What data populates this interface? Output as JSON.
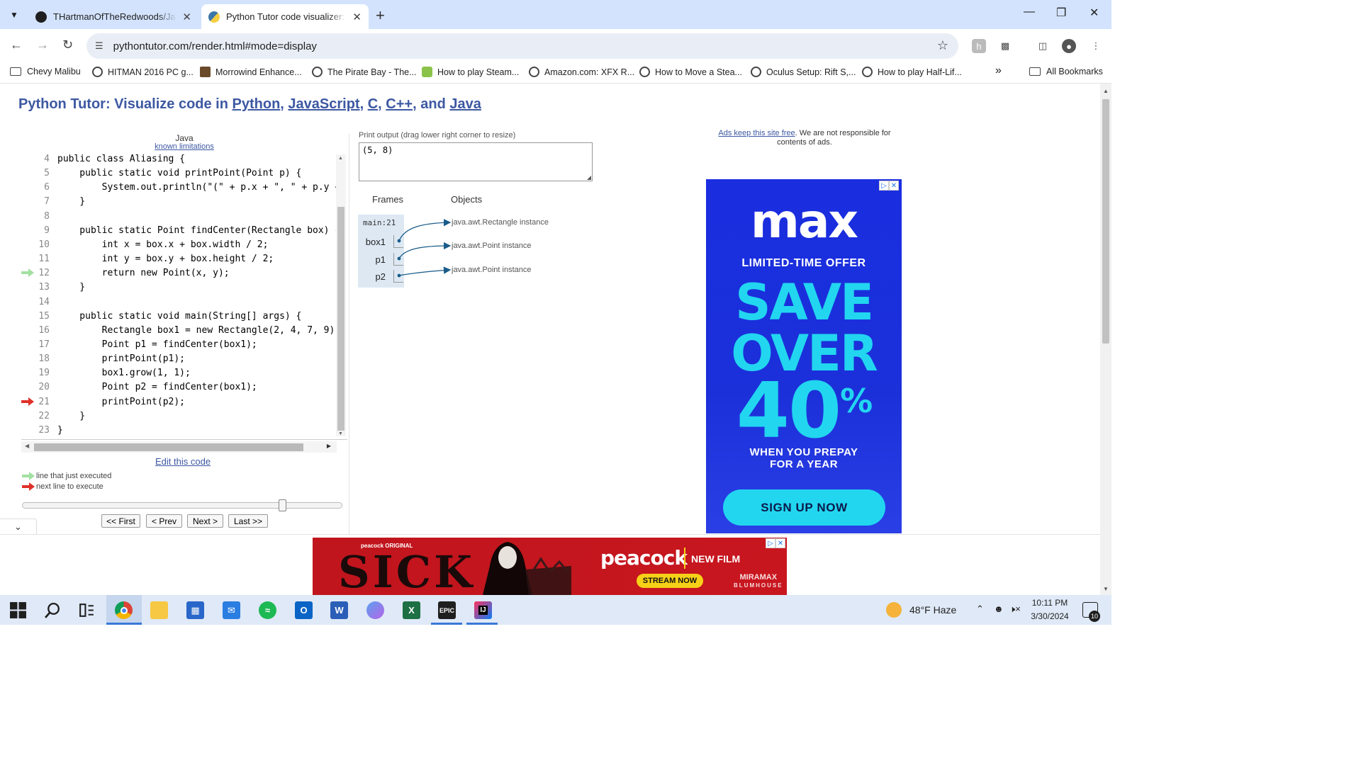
{
  "browser": {
    "tabs": [
      {
        "title": "THartmanOfTheRedwoods/Java",
        "active": false
      },
      {
        "title": "Python Tutor code visualizer: Vi",
        "active": true
      }
    ],
    "url": "pythontutor.com/render.html#mode=display",
    "bookmarks": [
      "Chevy Malibu",
      "HITMAN 2016 PC g...",
      "Morrowind Enhance...",
      "The Pirate Bay - The...",
      "How to play Steam...",
      "Amazon.com: XFX R...",
      "How to Move a Stea...",
      "Oculus Setup: Rift S,...",
      "How to play Half-Lif..."
    ],
    "all_bookmarks": "All Bookmarks",
    "overflow": "»"
  },
  "title": {
    "prefix": "Python Tutor: Visualize code in ",
    "python": "Python",
    "javascript": "JavaScript",
    "c": "C",
    "cpp": "C++",
    "and": ", and ",
    "java": "Java",
    "sep": ", "
  },
  "editor": {
    "language": "Java",
    "known_limitations": "known limitations",
    "lines": [
      {
        "num": "4",
        "code": "public class Aliasing {",
        "marker": ""
      },
      {
        "num": "5",
        "code": "    public static void printPoint(Point p) {",
        "marker": ""
      },
      {
        "num": "6",
        "code": "        System.out.println(\"(\" + p.x + \", \" + p.y + \"",
        "marker": ""
      },
      {
        "num": "7",
        "code": "    }",
        "marker": ""
      },
      {
        "num": "8",
        "code": "",
        "marker": ""
      },
      {
        "num": "9",
        "code": "    public static Point findCenter(Rectangle box) {",
        "marker": ""
      },
      {
        "num": "10",
        "code": "        int x = box.x + box.width / 2;",
        "marker": ""
      },
      {
        "num": "11",
        "code": "        int y = box.y + box.height / 2;",
        "marker": ""
      },
      {
        "num": "12",
        "code": "        return new Point(x, y);",
        "marker": "just-executed"
      },
      {
        "num": "13",
        "code": "    }",
        "marker": ""
      },
      {
        "num": "14",
        "code": "",
        "marker": ""
      },
      {
        "num": "15",
        "code": "    public static void main(String[] args) {",
        "marker": ""
      },
      {
        "num": "16",
        "code": "        Rectangle box1 = new Rectangle(2, 4, 7, 9);",
        "marker": ""
      },
      {
        "num": "17",
        "code": "        Point p1 = findCenter(box1);",
        "marker": ""
      },
      {
        "num": "18",
        "code": "        printPoint(p1);",
        "marker": ""
      },
      {
        "num": "19",
        "code": "        box1.grow(1, 1);",
        "marker": ""
      },
      {
        "num": "20",
        "code": "        Point p2 = findCenter(box1);",
        "marker": ""
      },
      {
        "num": "21",
        "code": "        printPoint(p2);",
        "marker": "next"
      },
      {
        "num": "22",
        "code": "    }",
        "marker": ""
      },
      {
        "num": "23",
        "code": "}",
        "marker": ""
      }
    ],
    "edit_link": "Edit this code",
    "legend_executed": "line that just executed",
    "legend_next": "next line to execute",
    "step_fraction": 0.82,
    "buttons": {
      "first": "<< First",
      "prev": "< Prev",
      "next": "Next >",
      "last": "Last >>"
    }
  },
  "visualizer": {
    "print_label": "Print output (drag lower right corner to resize)",
    "print_output": "(5, 8)",
    "frames_header": "Frames",
    "objects_header": "Objects",
    "frame_name": "main:21",
    "variables": [
      "box1",
      "p1",
      "p2"
    ],
    "objects": [
      "java.awt.Rectangle instance",
      "java.awt.Point instance",
      "java.awt.Point instance"
    ]
  },
  "ads": {
    "note_link": "Ads keep this site free",
    "note_rest": ". We are not responsible for contents of ads.",
    "max": {
      "logo": "max",
      "offer": "LIMITED-TIME OFFER",
      "line1": "SAVE",
      "line2": "OVER",
      "line3": "40",
      "pct": "%",
      "prepay1": "WHEN YOU PREPAY",
      "prepay2": "FOR A YEAR",
      "cta": "SIGN UP NOW"
    },
    "peacock": {
      "original": "peacock ORIGINAL",
      "title": "SICK",
      "brand": "peacock",
      "newfilm": "NEW FILM",
      "cta": "STREAM NOW",
      "studio1": "MIRAMAX",
      "studio2": "BLUMHOUSE"
    }
  },
  "taskbar": {
    "weather": "48°F  Haze",
    "time": "10:11 PM",
    "date": "3/30/2024",
    "notifications": "10",
    "apps": [
      "Start",
      "Search",
      "Task View",
      "Chrome",
      "File Explorer",
      "Microsoft Store",
      "Mail",
      "Spotify",
      "Outlook (new)",
      "Word",
      "Copilot",
      "Excel",
      "Epic Games",
      "IntelliJ IDEA"
    ]
  },
  "colors": {
    "title_blue": "#3d58a2",
    "arrow_executed": "#a2e0a2",
    "arrow_next": "#e0302a",
    "frame_bg": "#dde8f3",
    "max_cyan": "#22d6f0",
    "peacock_red": "#c0151d"
  }
}
